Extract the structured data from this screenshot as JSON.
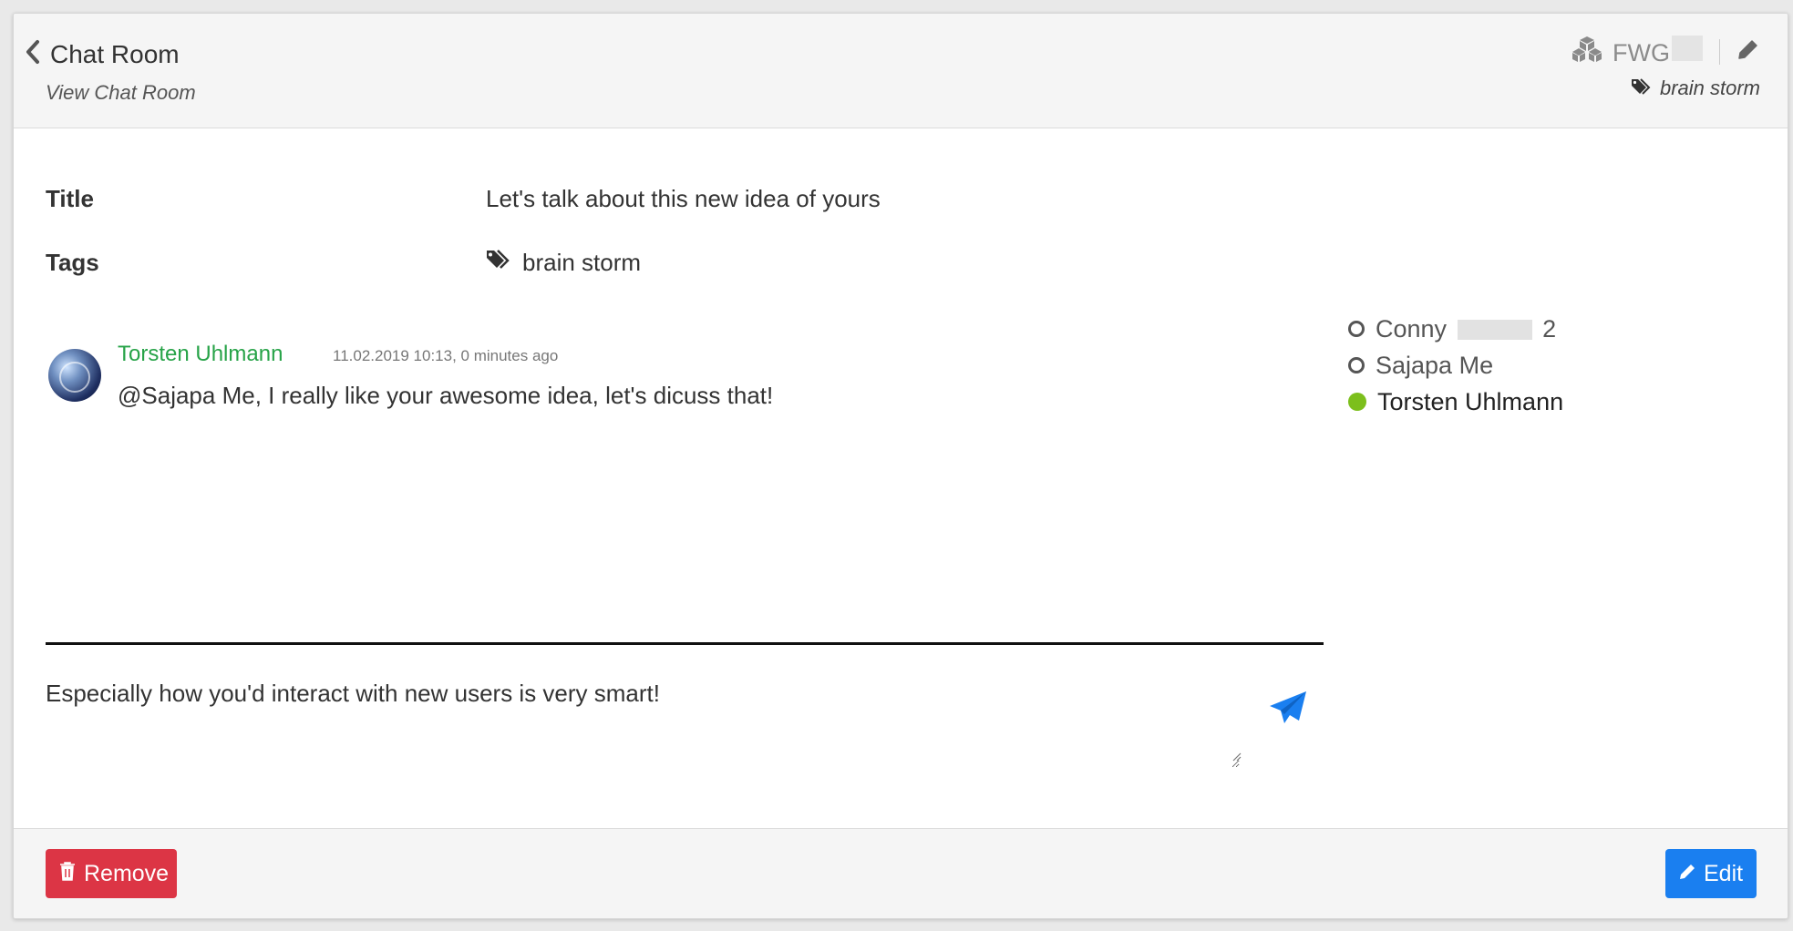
{
  "header": {
    "title": "Chat Room",
    "subtitle": "View Chat Room",
    "space_name": "FWG",
    "tag": "brain storm"
  },
  "fields": {
    "title_label": "Title",
    "title_value": "Let's talk about this new idea of yours",
    "tags_label": "Tags",
    "tags_value": "brain storm"
  },
  "message": {
    "author": "Torsten Uhlmann",
    "meta": "11.02.2019 10:13, 0 minutes ago",
    "text": "@Sajapa Me, I really like your awesome idea, let's dicuss that!"
  },
  "participants": [
    {
      "name_prefix": "Conny",
      "name_suffix": "2",
      "status": "offline"
    },
    {
      "name": "Sajapa Me",
      "status": "offline"
    },
    {
      "name": "Torsten Uhlmann",
      "status": "online"
    }
  ],
  "compose": {
    "value": "Especially how you'd interact with new users is very smart!"
  },
  "footer": {
    "remove_label": "Remove",
    "edit_label": "Edit"
  },
  "colors": {
    "author": "#27a348",
    "online": "#7cbf1c",
    "danger": "#dc3545",
    "primary": "#1a7ff0"
  }
}
